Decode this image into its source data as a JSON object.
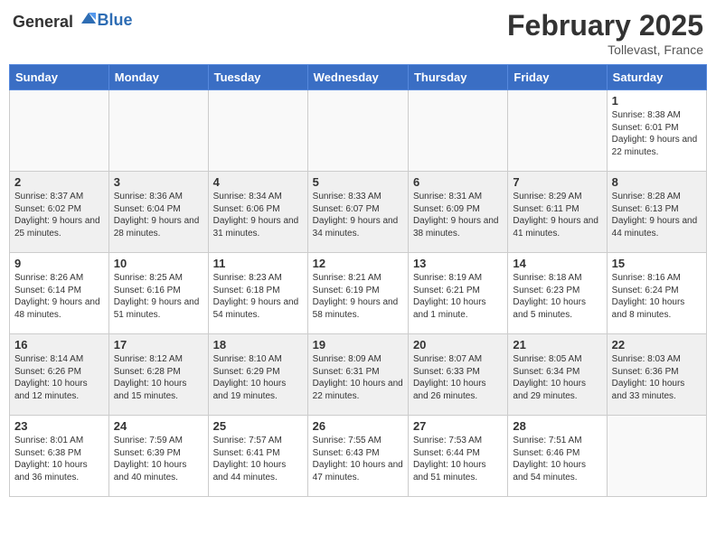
{
  "header": {
    "logo_general": "General",
    "logo_blue": "Blue",
    "month_title": "February 2025",
    "location": "Tollevast, France"
  },
  "weekdays": [
    "Sunday",
    "Monday",
    "Tuesday",
    "Wednesday",
    "Thursday",
    "Friday",
    "Saturday"
  ],
  "weeks": [
    [
      {
        "day": "",
        "info": ""
      },
      {
        "day": "",
        "info": ""
      },
      {
        "day": "",
        "info": ""
      },
      {
        "day": "",
        "info": ""
      },
      {
        "day": "",
        "info": ""
      },
      {
        "day": "",
        "info": ""
      },
      {
        "day": "1",
        "info": "Sunrise: 8:38 AM\nSunset: 6:01 PM\nDaylight: 9 hours and 22 minutes."
      }
    ],
    [
      {
        "day": "2",
        "info": "Sunrise: 8:37 AM\nSunset: 6:02 PM\nDaylight: 9 hours and 25 minutes."
      },
      {
        "day": "3",
        "info": "Sunrise: 8:36 AM\nSunset: 6:04 PM\nDaylight: 9 hours and 28 minutes."
      },
      {
        "day": "4",
        "info": "Sunrise: 8:34 AM\nSunset: 6:06 PM\nDaylight: 9 hours and 31 minutes."
      },
      {
        "day": "5",
        "info": "Sunrise: 8:33 AM\nSunset: 6:07 PM\nDaylight: 9 hours and 34 minutes."
      },
      {
        "day": "6",
        "info": "Sunrise: 8:31 AM\nSunset: 6:09 PM\nDaylight: 9 hours and 38 minutes."
      },
      {
        "day": "7",
        "info": "Sunrise: 8:29 AM\nSunset: 6:11 PM\nDaylight: 9 hours and 41 minutes."
      },
      {
        "day": "8",
        "info": "Sunrise: 8:28 AM\nSunset: 6:13 PM\nDaylight: 9 hours and 44 minutes."
      }
    ],
    [
      {
        "day": "9",
        "info": "Sunrise: 8:26 AM\nSunset: 6:14 PM\nDaylight: 9 hours and 48 minutes."
      },
      {
        "day": "10",
        "info": "Sunrise: 8:25 AM\nSunset: 6:16 PM\nDaylight: 9 hours and 51 minutes."
      },
      {
        "day": "11",
        "info": "Sunrise: 8:23 AM\nSunset: 6:18 PM\nDaylight: 9 hours and 54 minutes."
      },
      {
        "day": "12",
        "info": "Sunrise: 8:21 AM\nSunset: 6:19 PM\nDaylight: 9 hours and 58 minutes."
      },
      {
        "day": "13",
        "info": "Sunrise: 8:19 AM\nSunset: 6:21 PM\nDaylight: 10 hours and 1 minute."
      },
      {
        "day": "14",
        "info": "Sunrise: 8:18 AM\nSunset: 6:23 PM\nDaylight: 10 hours and 5 minutes."
      },
      {
        "day": "15",
        "info": "Sunrise: 8:16 AM\nSunset: 6:24 PM\nDaylight: 10 hours and 8 minutes."
      }
    ],
    [
      {
        "day": "16",
        "info": "Sunrise: 8:14 AM\nSunset: 6:26 PM\nDaylight: 10 hours and 12 minutes."
      },
      {
        "day": "17",
        "info": "Sunrise: 8:12 AM\nSunset: 6:28 PM\nDaylight: 10 hours and 15 minutes."
      },
      {
        "day": "18",
        "info": "Sunrise: 8:10 AM\nSunset: 6:29 PM\nDaylight: 10 hours and 19 minutes."
      },
      {
        "day": "19",
        "info": "Sunrise: 8:09 AM\nSunset: 6:31 PM\nDaylight: 10 hours and 22 minutes."
      },
      {
        "day": "20",
        "info": "Sunrise: 8:07 AM\nSunset: 6:33 PM\nDaylight: 10 hours and 26 minutes."
      },
      {
        "day": "21",
        "info": "Sunrise: 8:05 AM\nSunset: 6:34 PM\nDaylight: 10 hours and 29 minutes."
      },
      {
        "day": "22",
        "info": "Sunrise: 8:03 AM\nSunset: 6:36 PM\nDaylight: 10 hours and 33 minutes."
      }
    ],
    [
      {
        "day": "23",
        "info": "Sunrise: 8:01 AM\nSunset: 6:38 PM\nDaylight: 10 hours and 36 minutes."
      },
      {
        "day": "24",
        "info": "Sunrise: 7:59 AM\nSunset: 6:39 PM\nDaylight: 10 hours and 40 minutes."
      },
      {
        "day": "25",
        "info": "Sunrise: 7:57 AM\nSunset: 6:41 PM\nDaylight: 10 hours and 44 minutes."
      },
      {
        "day": "26",
        "info": "Sunrise: 7:55 AM\nSunset: 6:43 PM\nDaylight: 10 hours and 47 minutes."
      },
      {
        "day": "27",
        "info": "Sunrise: 7:53 AM\nSunset: 6:44 PM\nDaylight: 10 hours and 51 minutes."
      },
      {
        "day": "28",
        "info": "Sunrise: 7:51 AM\nSunset: 6:46 PM\nDaylight: 10 hours and 54 minutes."
      },
      {
        "day": "",
        "info": ""
      }
    ]
  ]
}
